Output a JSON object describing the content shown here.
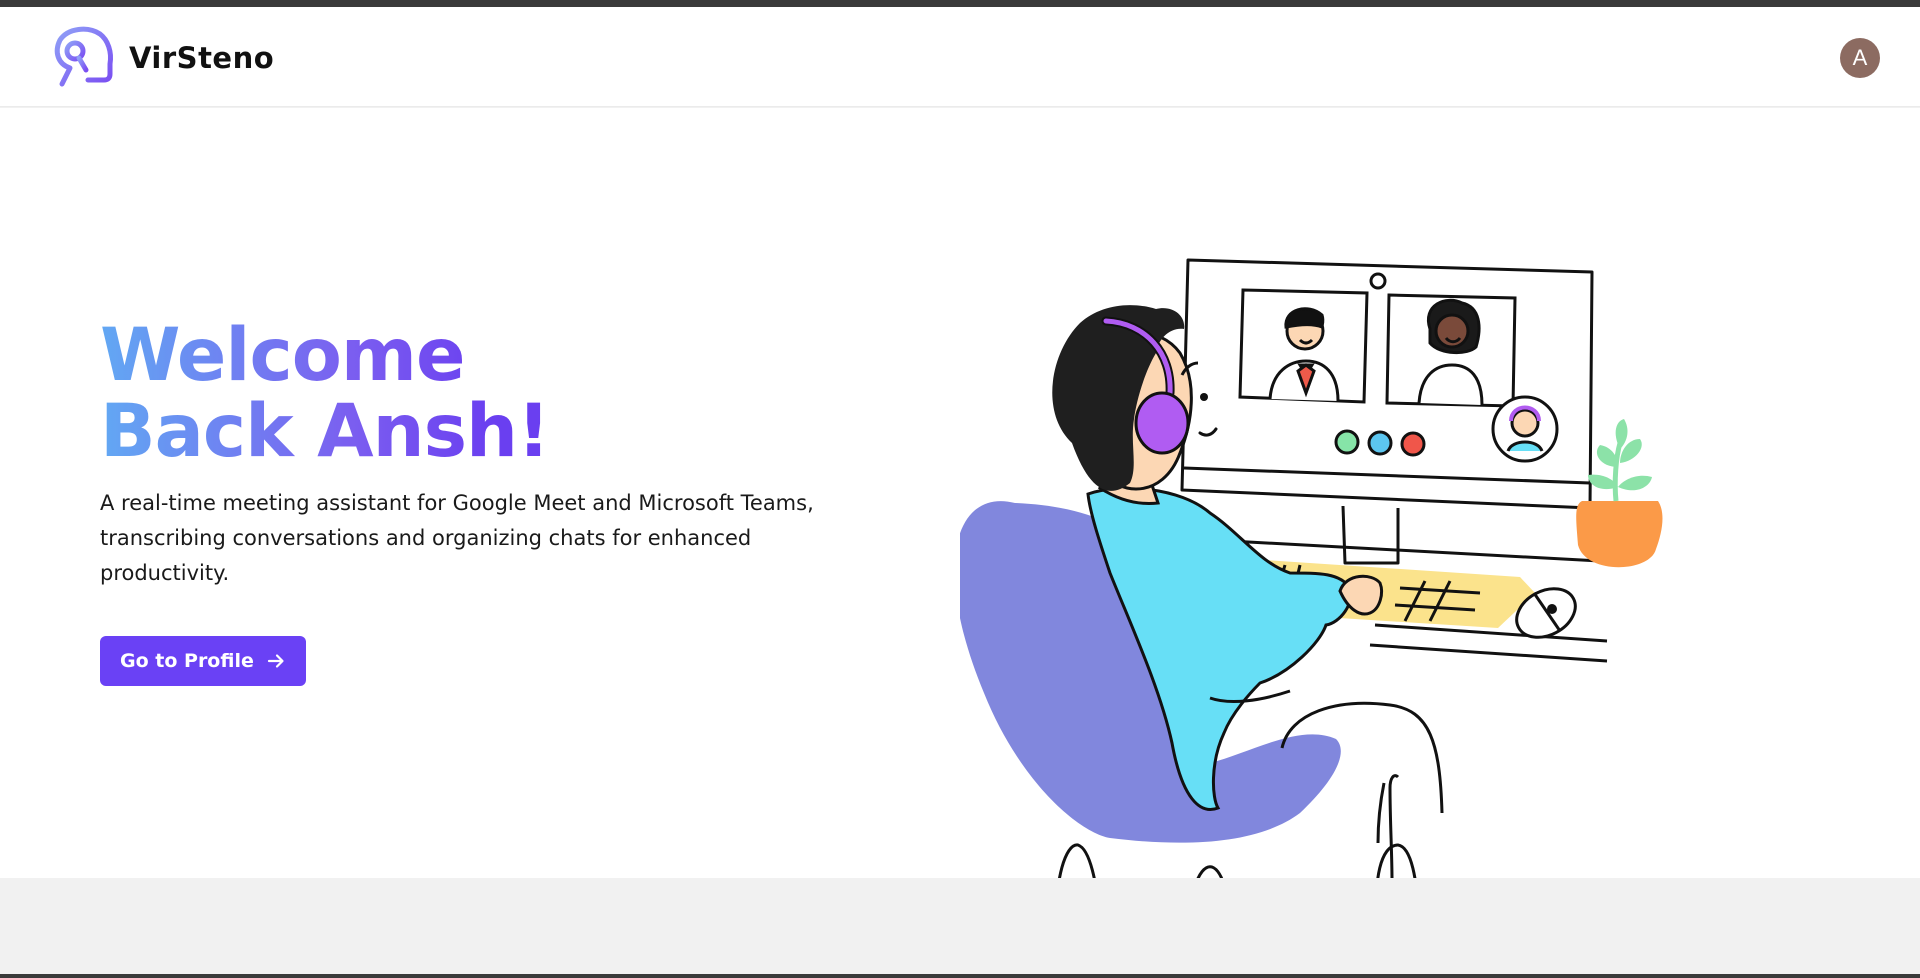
{
  "header": {
    "brand": "VirSteno",
    "avatar_initial": "A",
    "logo_icon": "virsteno-logo-icon"
  },
  "hero": {
    "title": "Welcome Back Ansh!",
    "description": "A real-time meeting assistant for Google Meet and Microsoft Teams, transcribing conversations and organizing chats for enhanced productivity.",
    "cta_label": "Go to Profile",
    "cta_icon": "arrow-right-icon",
    "illustration": "person-in-video-meeting-illustration"
  },
  "colors": {
    "accent": "#6a41f5",
    "title_gradient_start": "#62a8f3",
    "title_gradient_end": "#6a3ff0",
    "avatar_bg": "#8c6b61"
  }
}
